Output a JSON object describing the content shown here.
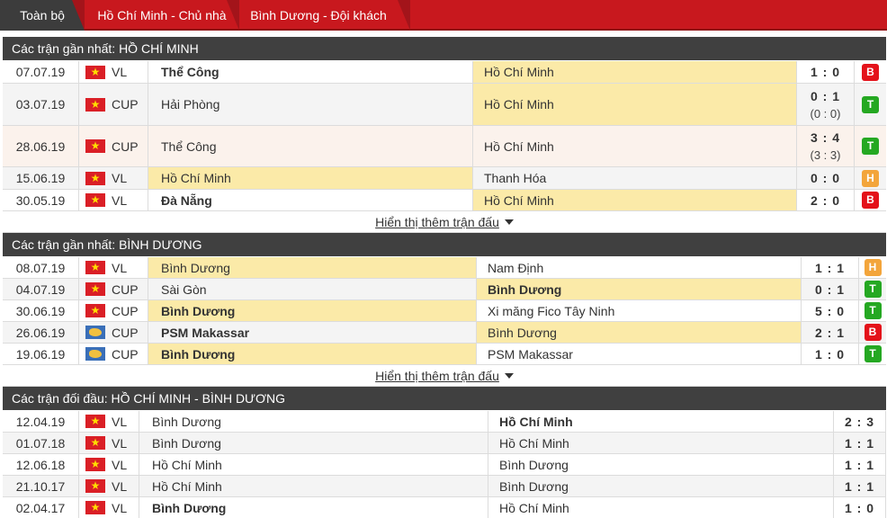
{
  "tabs": [
    "Toàn bộ",
    "Hồ Chí Minh - Chủ nhà",
    "Bình Dương - Đội khách"
  ],
  "more_label": "Hiển thị thêm trận đấu",
  "sections": [
    {
      "title": "Các trận gần nhất: HỒ CHÍ MINH",
      "matches": [
        {
          "date": "07.07.19",
          "flag": "vn",
          "comp": "VL",
          "home": "Thể Công",
          "away": "Hồ Chí Minh",
          "score": "1 : 0",
          "sub": "",
          "result": "B",
          "home_bold": true,
          "away_bold": false,
          "hl": "away"
        },
        {
          "date": "03.07.19",
          "flag": "vn",
          "comp": "CUP",
          "home": "Hải Phòng",
          "away": "Hồ Chí Minh",
          "score": "0 : 1",
          "sub": "(0 : 0)",
          "result": "T",
          "home_bold": false,
          "away_bold": false,
          "hl": "away"
        },
        {
          "date": "28.06.19",
          "flag": "vn",
          "comp": "CUP",
          "home": "Thể Công",
          "away": "Hồ Chí Minh",
          "score": "3 : 4",
          "sub": "(3 : 3)",
          "result": "T",
          "home_bold": false,
          "away_bold": false,
          "hl": "none"
        },
        {
          "date": "15.06.19",
          "flag": "vn",
          "comp": "VL",
          "home": "Hồ Chí Minh",
          "away": "Thanh Hóa",
          "score": "0 : 0",
          "sub": "",
          "result": "H",
          "home_bold": false,
          "away_bold": false,
          "hl": "home"
        },
        {
          "date": "30.05.19",
          "flag": "vn",
          "comp": "VL",
          "home": "Đà Nẵng",
          "away": "Hồ Chí Minh",
          "score": "2 : 0",
          "sub": "",
          "result": "B",
          "home_bold": true,
          "away_bold": false,
          "hl": "away"
        }
      ]
    },
    {
      "title": "Các trận gần nhất: BÌNH DƯƠNG",
      "matches": [
        {
          "date": "08.07.19",
          "flag": "vn",
          "comp": "VL",
          "home": "Bình Dương",
          "away": "Nam Định",
          "score": "1 : 1",
          "sub": "",
          "result": "H",
          "home_bold": false,
          "away_bold": false,
          "hl": "home"
        },
        {
          "date": "04.07.19",
          "flag": "vn",
          "comp": "CUP",
          "home": "Sài Gòn",
          "away": "Bình Dương",
          "score": "0 : 1",
          "sub": "",
          "result": "T",
          "home_bold": false,
          "away_bold": true,
          "hl": "away"
        },
        {
          "date": "30.06.19",
          "flag": "vn",
          "comp": "CUP",
          "home": "Bình Dương",
          "away": "Xi măng Fico Tây Ninh",
          "score": "5 : 0",
          "sub": "",
          "result": "T",
          "home_bold": true,
          "away_bold": false,
          "hl": "home"
        },
        {
          "date": "26.06.19",
          "flag": "world",
          "comp": "CUP",
          "home": "PSM Makassar",
          "away": "Bình Dương",
          "score": "2 : 1",
          "sub": "",
          "result": "B",
          "home_bold": true,
          "away_bold": false,
          "hl": "away"
        },
        {
          "date": "19.06.19",
          "flag": "world",
          "comp": "CUP",
          "home": "Bình Dương",
          "away": "PSM Makassar",
          "score": "1 : 0",
          "sub": "",
          "result": "T",
          "home_bold": true,
          "away_bold": false,
          "hl": "home"
        }
      ]
    },
    {
      "title": "Các trận đối đầu: HỒ CHÍ MINH - BÌNH DƯƠNG",
      "matches": [
        {
          "date": "12.04.19",
          "flag": "vn",
          "comp": "VL",
          "home": "Bình Dương",
          "away": "Hồ Chí Minh",
          "score": "2 : 3",
          "sub": "",
          "result": "",
          "home_bold": false,
          "away_bold": true,
          "hl": "none"
        },
        {
          "date": "01.07.18",
          "flag": "vn",
          "comp": "VL",
          "home": "Bình Dương",
          "away": "Hồ Chí Minh",
          "score": "1 : 1",
          "sub": "",
          "result": "",
          "home_bold": false,
          "away_bold": false,
          "hl": "none"
        },
        {
          "date": "12.06.18",
          "flag": "vn",
          "comp": "VL",
          "home": "Hồ Chí Minh",
          "away": "Bình Dương",
          "score": "1 : 1",
          "sub": "",
          "result": "",
          "home_bold": false,
          "away_bold": false,
          "hl": "none"
        },
        {
          "date": "21.10.17",
          "flag": "vn",
          "comp": "VL",
          "home": "Hồ Chí Minh",
          "away": "Bình Dương",
          "score": "1 : 1",
          "sub": "",
          "result": "",
          "home_bold": false,
          "away_bold": false,
          "hl": "none"
        },
        {
          "date": "02.04.17",
          "flag": "vn",
          "comp": "VL",
          "home": "Bình Dương",
          "away": "Hồ Chí Minh",
          "score": "1 : 0",
          "sub": "",
          "result": "",
          "home_bold": true,
          "away_bold": false,
          "hl": "none"
        }
      ]
    }
  ]
}
